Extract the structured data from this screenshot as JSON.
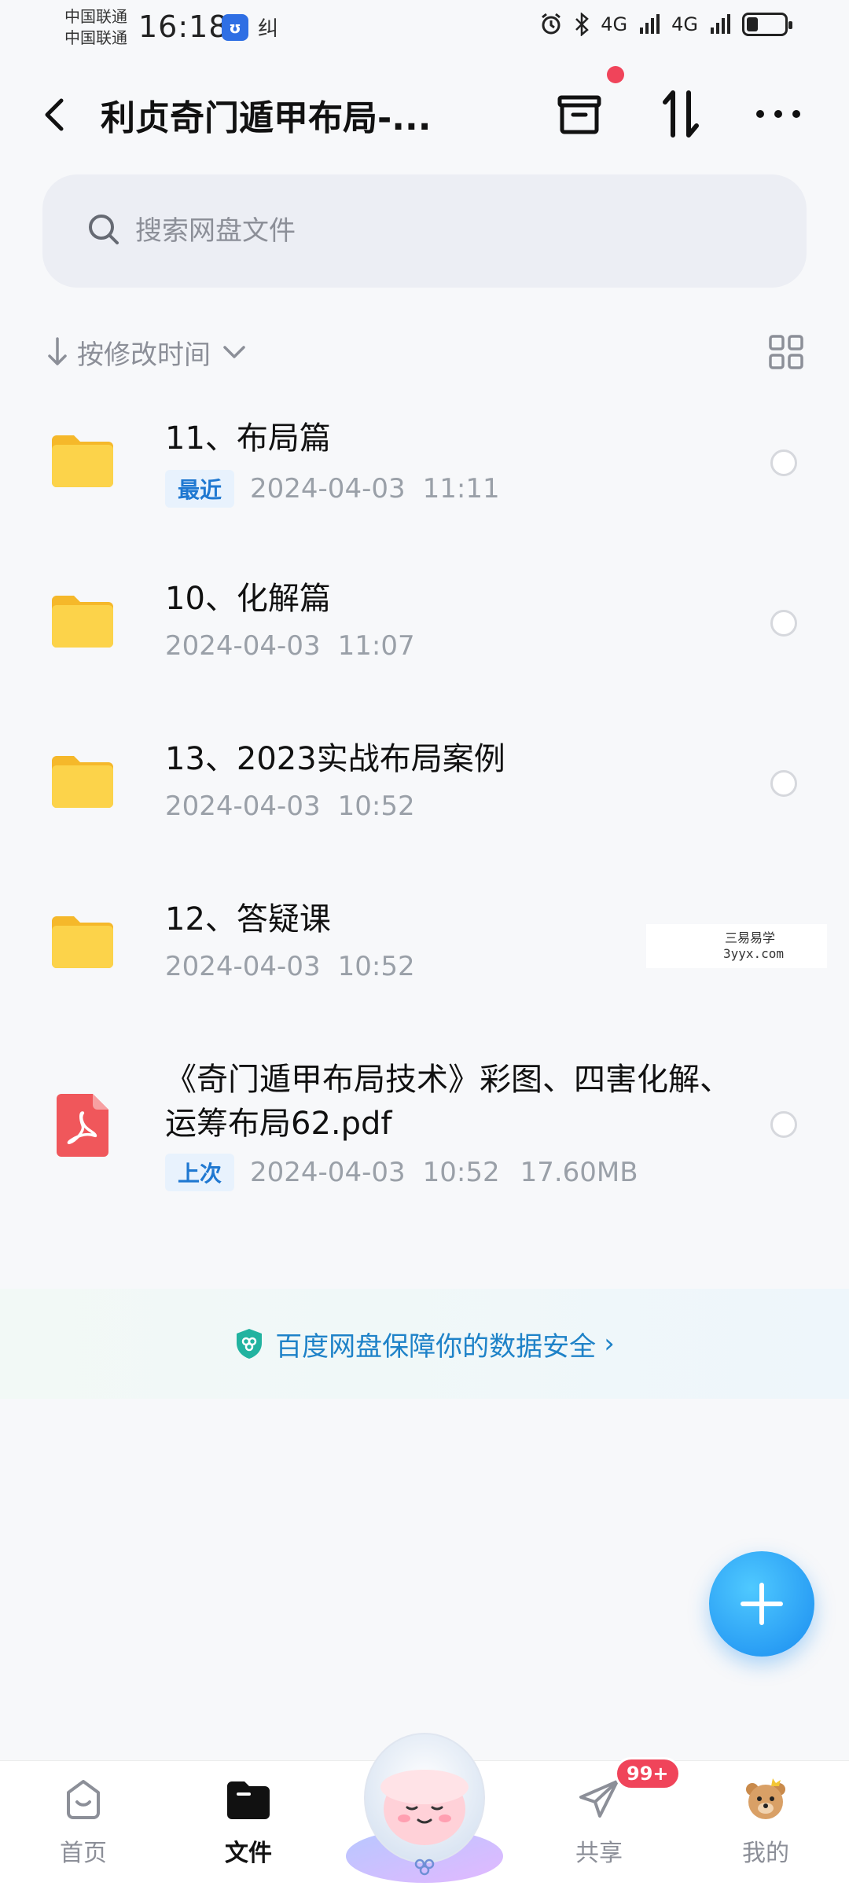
{
  "status_bar": {
    "carrier_1": "中国联通",
    "carrier_2": "中国联通",
    "time": "16:18",
    "app_icon_glyph": "ʊ",
    "extra_glyph": "纠",
    "network_1": "4G",
    "network_2": "4G"
  },
  "header": {
    "title": "利贞奇门遁甲布局-...",
    "icons": [
      "back-arrow",
      "archive-box",
      "sort-transfer",
      "more-dots"
    ]
  },
  "search": {
    "placeholder": "搜索网盘文件"
  },
  "sort": {
    "label": "按修改时间"
  },
  "files": [
    {
      "name": "11、布局篇",
      "tag": "最近",
      "date": "2024-04-03",
      "time": "11:11",
      "size": "",
      "type": "folder"
    },
    {
      "name": "10、化解篇",
      "tag": "",
      "date": "2024-04-03",
      "time": "11:07",
      "size": "",
      "type": "folder"
    },
    {
      "name": "13、2023实战布局案例",
      "tag": "",
      "date": "2024-04-03",
      "time": "10:52",
      "size": "",
      "type": "folder"
    },
    {
      "name": "12、答疑课",
      "tag": "",
      "date": "2024-04-03",
      "time": "10:52",
      "size": "",
      "type": "folder"
    },
    {
      "name": "《奇门遁甲布局技术》彩图、四害化解、运筹布局62.pdf",
      "tag": "上次",
      "date": "2024-04-03",
      "time": "10:52",
      "size": "17.60MB",
      "type": "pdf"
    }
  ],
  "watermark": {
    "line1": "三易易学",
    "line2": "3yyx.com"
  },
  "security_banner": {
    "text": "百度网盘保障你的数据安全",
    "chevron": "›"
  },
  "bottom_nav": {
    "home": "首页",
    "files": "文件",
    "share": "共享",
    "me": "我的",
    "share_badge": "99+"
  },
  "colors": {
    "accent": "#1f78d1",
    "folder": "#f9c833",
    "pdf": "#f0575b",
    "badge": "#f0445a",
    "fab": "#1a8cf0"
  }
}
